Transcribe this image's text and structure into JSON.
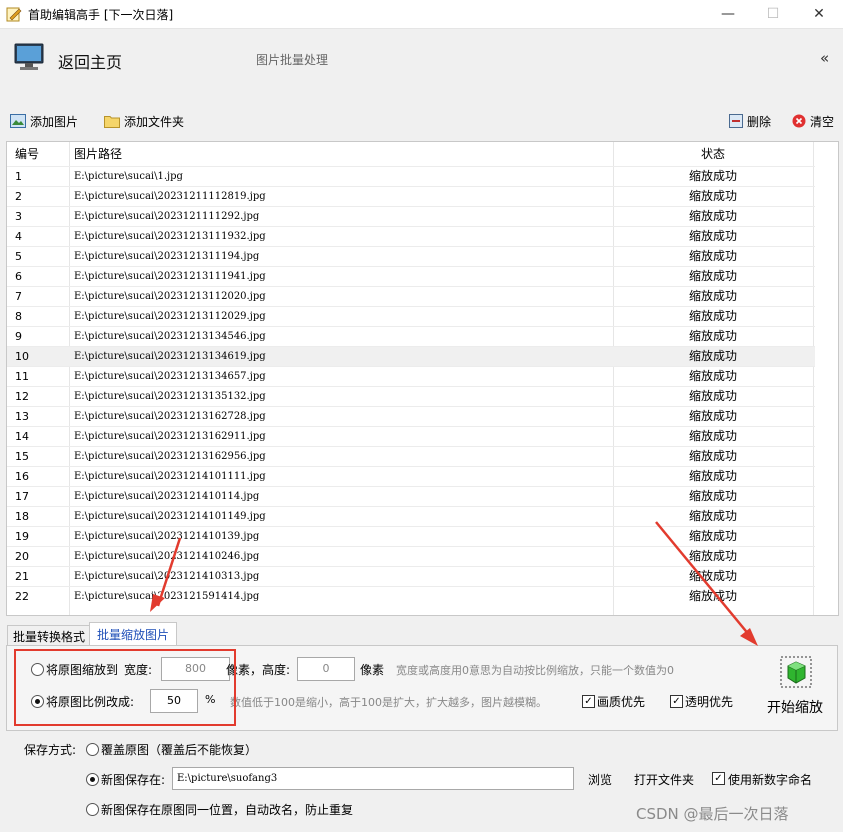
{
  "window": {
    "title": "首助编辑高手 [下一次日落]",
    "minimize": "—",
    "maximize": "☐",
    "close": "✕"
  },
  "header": {
    "home_label": "返回主页",
    "subtitle": "图片批量处理",
    "collapse": "«"
  },
  "toolbar": {
    "add_image": "添加图片",
    "add_folder": "添加文件夹",
    "delete": "删除",
    "clear": "清空"
  },
  "table": {
    "columns": [
      "编号",
      "图片路径",
      "状态"
    ],
    "rows": [
      {
        "no": "1",
        "path": "E:\\picture\\sucai\\1.jpg",
        "status": "缩放成功"
      },
      {
        "no": "2",
        "path": "E:\\picture\\sucai\\20231211112819.jpg",
        "status": "缩放成功"
      },
      {
        "no": "3",
        "path": "E:\\picture\\sucai\\2023121111292.jpg",
        "status": "缩放成功"
      },
      {
        "no": "4",
        "path": "E:\\picture\\sucai\\20231213111932.jpg",
        "status": "缩放成功"
      },
      {
        "no": "5",
        "path": "E:\\picture\\sucai\\2023121311194.jpg",
        "status": "缩放成功"
      },
      {
        "no": "6",
        "path": "E:\\picture\\sucai\\20231213111941.jpg",
        "status": "缩放成功"
      },
      {
        "no": "7",
        "path": "E:\\picture\\sucai\\20231213112020.jpg",
        "status": "缩放成功"
      },
      {
        "no": "8",
        "path": "E:\\picture\\sucai\\20231213112029.jpg",
        "status": "缩放成功"
      },
      {
        "no": "9",
        "path": "E:\\picture\\sucai\\20231213134546.jpg",
        "status": "缩放成功"
      },
      {
        "no": "10",
        "path": "E:\\picture\\sucai\\20231213134619.jpg",
        "status": "缩放成功"
      },
      {
        "no": "11",
        "path": "E:\\picture\\sucai\\20231213134657.jpg",
        "status": "缩放成功"
      },
      {
        "no": "12",
        "path": "E:\\picture\\sucai\\20231213135132.jpg",
        "status": "缩放成功"
      },
      {
        "no": "13",
        "path": "E:\\picture\\sucai\\20231213162728.jpg",
        "status": "缩放成功"
      },
      {
        "no": "14",
        "path": "E:\\picture\\sucai\\20231213162911.jpg",
        "status": "缩放成功"
      },
      {
        "no": "15",
        "path": "E:\\picture\\sucai\\20231213162956.jpg",
        "status": "缩放成功"
      },
      {
        "no": "16",
        "path": "E:\\picture\\sucai\\20231214101111.jpg",
        "status": "缩放成功"
      },
      {
        "no": "17",
        "path": "E:\\picture\\sucai\\2023121410114.jpg",
        "status": "缩放成功"
      },
      {
        "no": "18",
        "path": "E:\\picture\\sucai\\20231214101149.jpg",
        "status": "缩放成功"
      },
      {
        "no": "19",
        "path": "E:\\picture\\sucai\\2023121410139.jpg",
        "status": "缩放成功"
      },
      {
        "no": "20",
        "path": "E:\\picture\\sucai\\2023121410246.jpg",
        "status": "缩放成功"
      },
      {
        "no": "21",
        "path": "E:\\picture\\sucai\\2023121410313.jpg",
        "status": "缩放成功"
      },
      {
        "no": "22",
        "path": "E:\\picture\\sucai\\2023121591414.jpg",
        "status": "缩放成功"
      }
    ],
    "selected_row": "10"
  },
  "tabs": {
    "convert": "批量转换格式",
    "resize": "批量缩放图片"
  },
  "resize": {
    "mode_fixed_label": "将原图缩放到",
    "width_label": "宽度:",
    "width_value": "800",
    "pixel_label": "像素，高度:",
    "height_value": "0",
    "pixel_label2": "像素",
    "fixed_hint": "宽度或高度用0意思为自动按比例缩放，只能一个数值为0",
    "mode_ratio_label": "将原图比例改成:",
    "ratio_value": "50",
    "percent": "%",
    "ratio_hint": "数值低于100是缩小，高于100是扩大，扩大越多，图片越模糊。",
    "quality_first": "画质优先",
    "transparent_first": "透明优先",
    "start_button": "开始缩放"
  },
  "save": {
    "label": "保存方式:",
    "overwrite": "覆盖原图（覆盖后不能恢复）",
    "new_path_label": "新图保存在:",
    "new_path_value": "E:\\picture\\suofang3",
    "browse": "浏览",
    "open_folder": "打开文件夹",
    "use_new_name": "使用新数字命名",
    "same_location": "新图保存在原图同一位置，自动改名，防止重复"
  },
  "watermark": "CSDN @最后一次日落",
  "colors": {
    "accent_red": "#e23b2e",
    "tab_blue": "#1f4fb8"
  }
}
